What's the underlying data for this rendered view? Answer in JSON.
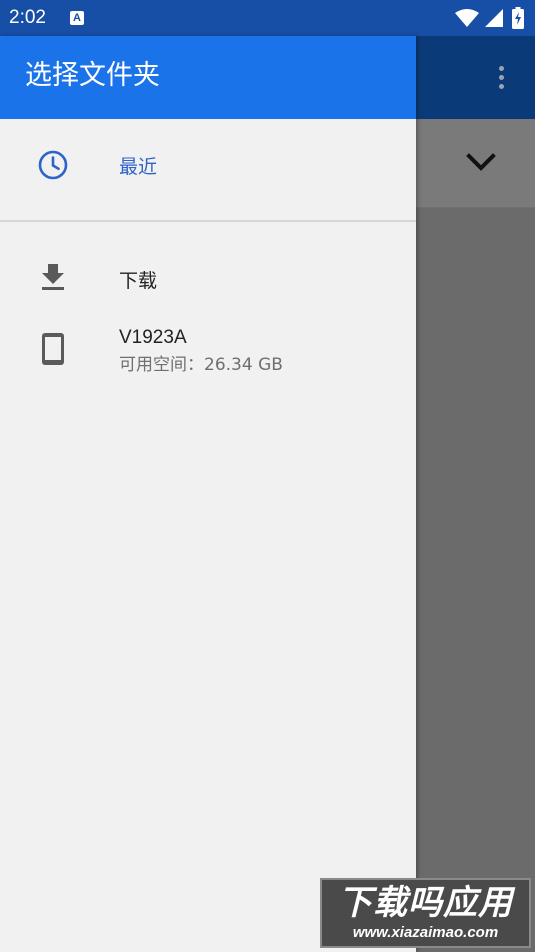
{
  "status_bar": {
    "time": "2:02",
    "app_badge": "A",
    "icons": [
      "wifi-icon",
      "signal-icon",
      "battery-icon"
    ]
  },
  "background_app": {
    "overflow_icon": "more-vert-icon",
    "bracket_text": "]",
    "dropdown_icon": "chevron-down-icon"
  },
  "drawer": {
    "title": "选择文件夹",
    "items": [
      {
        "label": "最近",
        "icon": "clock-icon",
        "selected": true
      },
      {
        "label": "下载",
        "icon": "download-icon",
        "selected": false
      },
      {
        "label": "V1923A",
        "sublabel": "可用空间：26.34 GB",
        "icon": "phone-icon",
        "selected": false
      }
    ]
  },
  "watermark": {
    "title": "下载吗应用",
    "url": "www.xiazaimao.com"
  },
  "colors": {
    "status_bar": "#174ea6",
    "drawer_header": "#1a73e8",
    "selected_text": "#2f63c9",
    "scrim": "#6b6b6b"
  }
}
